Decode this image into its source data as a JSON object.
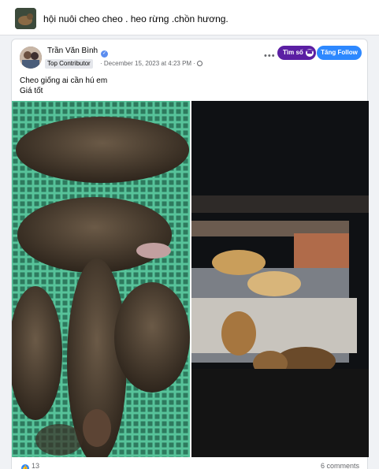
{
  "group": {
    "title": "hội nuôi cheo cheo . heo rừng .chồn hương."
  },
  "post": {
    "author": "Trần Văn Bình",
    "badge": "Top Contributor",
    "meta": "· December 15, 2023 at 4:23 PM ·",
    "more_icon": "more-dots-icon",
    "find_button": "Tìm số",
    "follow_button": "Tăng Follow",
    "text_line1": "Cheo giống ai cần hú em",
    "text_line2": "Giá tốt",
    "reaction_count": "13",
    "comment_count": "6 comments"
  },
  "colors": {
    "find_button": "#5b1fa3",
    "follow_button": "#2d88ff",
    "crate_green": "#57c39a"
  }
}
